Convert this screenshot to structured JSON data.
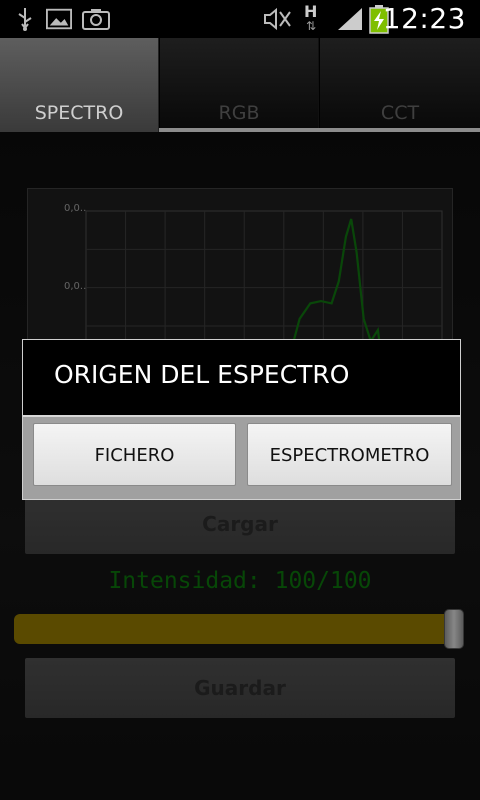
{
  "status_bar": {
    "time": "12:23",
    "left_icons": [
      "usb-icon",
      "image-icon",
      "camera-icon"
    ],
    "right_icons": [
      "mute-icon",
      "data-h-icon",
      "signal-icon",
      "battery-charging-icon"
    ],
    "network_label": "H"
  },
  "tabs": [
    {
      "label": "SPECTRO",
      "selected": true
    },
    {
      "label": "RGB",
      "selected": false
    },
    {
      "label": "CCT",
      "selected": false
    }
  ],
  "chart": {
    "y_tick_labels": [
      "0,0..",
      "0,0.."
    ]
  },
  "chart_data": {
    "type": "line",
    "series": [
      {
        "color": "#0e6e0e",
        "points": [
          [
            0.0,
            0
          ],
          [
            0.4,
            0
          ],
          [
            0.55,
            0.25
          ],
          [
            0.6,
            0.55
          ],
          [
            0.63,
            0.62
          ],
          [
            0.66,
            0.63
          ],
          [
            0.69,
            0.62
          ],
          [
            0.71,
            0.72
          ],
          [
            0.73,
            0.92
          ],
          [
            0.745,
            1.0
          ],
          [
            0.76,
            0.85
          ],
          [
            0.78,
            0.55
          ],
          [
            0.8,
            0.45
          ],
          [
            0.82,
            0.5
          ],
          [
            0.84,
            0.25
          ],
          [
            0.86,
            0.0
          ]
        ]
      }
    ]
  },
  "buttons": {
    "cargar": "Cargar",
    "guardar": "Guardar"
  },
  "intensity_label": "Intensidad: 100/100",
  "slider": {
    "value": 100,
    "max": 100,
    "color": "#7a6600"
  },
  "dialog": {
    "title": "ORIGEN DEL ESPECTRO",
    "options": [
      "FICHERO",
      "ESPECTROMETRO"
    ]
  }
}
